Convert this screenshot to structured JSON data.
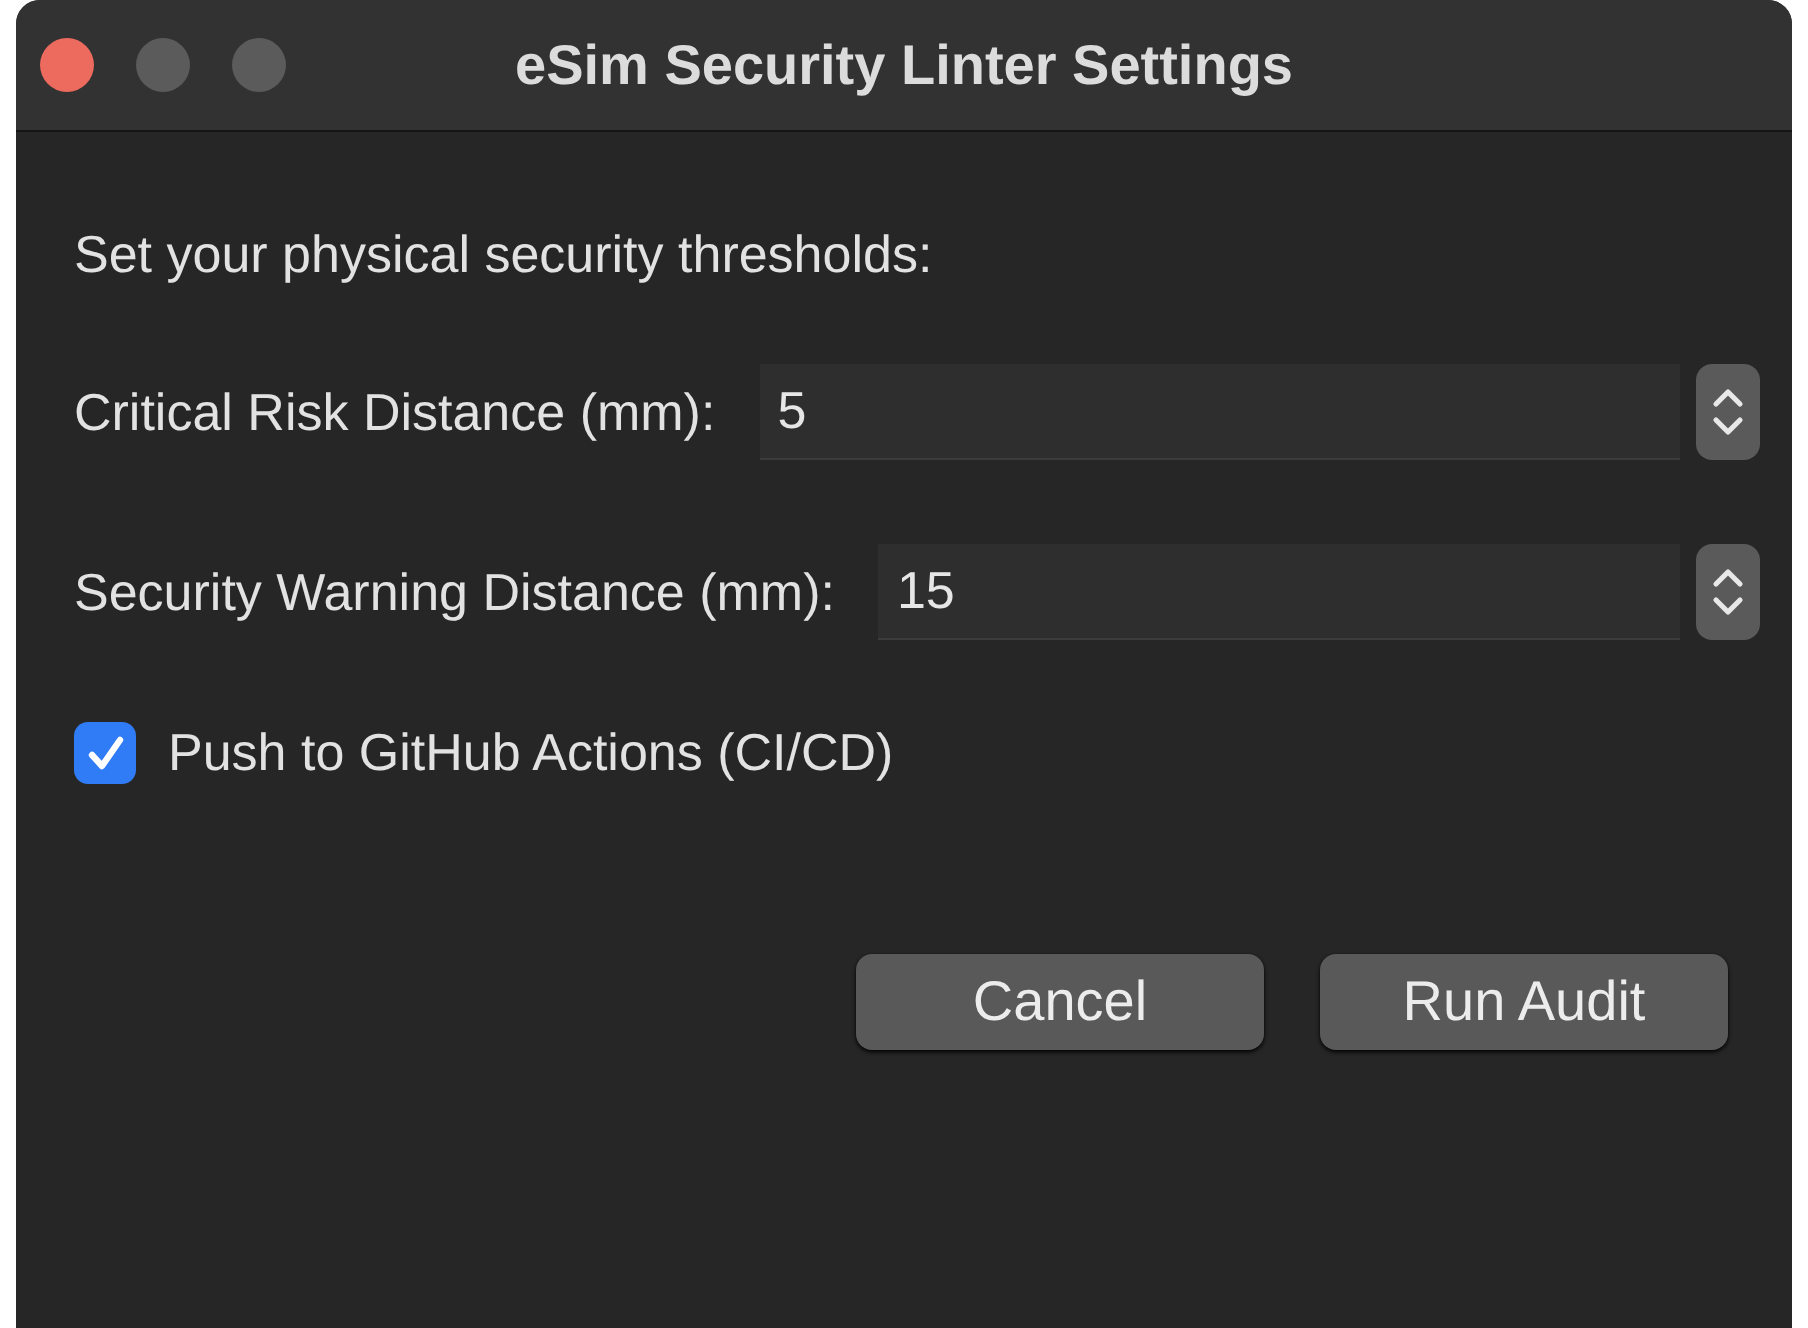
{
  "window": {
    "title": "eSim Security Linter Settings"
  },
  "prompt": "Set your physical security thresholds:",
  "fields": [
    {
      "label": "Critical Risk Distance (mm):",
      "value": "5"
    },
    {
      "label": "Security Warning Distance (mm):",
      "value": "15"
    }
  ],
  "checkbox": {
    "label": "Push to GitHub Actions (CI/CD)",
    "checked": true
  },
  "buttons": [
    {
      "label": "Cancel"
    },
    {
      "label": "Run Audit"
    }
  ]
}
